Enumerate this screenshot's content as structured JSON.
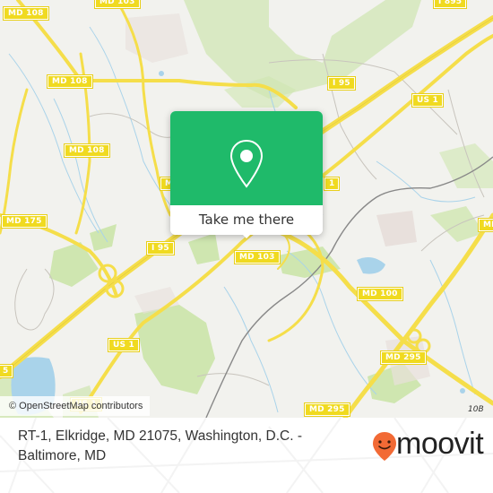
{
  "map": {
    "road_labels": [
      {
        "id": "md108-top",
        "text": "MD 108"
      },
      {
        "id": "md103-top",
        "text": "MD 103"
      },
      {
        "id": "i895-top",
        "text": "I 895"
      },
      {
        "id": "md108-mid",
        "text": "MD 108"
      },
      {
        "id": "i95-upper",
        "text": "I 95"
      },
      {
        "id": "us1-upper",
        "text": "US 1"
      },
      {
        "id": "md108-lower",
        "text": "MD 108"
      },
      {
        "id": "md-left-partial",
        "text": "M"
      },
      {
        "id": "us1-right-partial",
        "text": "1"
      },
      {
        "id": "md175",
        "text": "MD 175"
      },
      {
        "id": "i95-lower",
        "text": "I 95"
      },
      {
        "id": "md103",
        "text": "MD 103"
      },
      {
        "id": "md-right-partial",
        "text": "MD"
      },
      {
        "id": "md100",
        "text": "MD 100"
      },
      {
        "id": "us1-mid",
        "text": "US 1"
      },
      {
        "id": "md295-mid",
        "text": "MD 295"
      },
      {
        "id": "i95-left-partial",
        "text": "5"
      },
      {
        "id": "us1-low",
        "text": "US 1"
      },
      {
        "id": "md295-bottom",
        "text": "MD 295"
      }
    ],
    "exit_label": "10B",
    "colors": {
      "land": "#f2f2ee",
      "road": "#f5de4a",
      "park": "#c9e5a8",
      "water": "#a9d3ea",
      "shield": "#f0da20"
    }
  },
  "popup": {
    "icon": "map-pin-icon",
    "button_label": "Take me there",
    "color": "#1fba6a"
  },
  "attribution": "© OpenStreetMap contributors",
  "footer": {
    "address": "RT-1, Elkridge, MD 21075, Washington, D.C. - Baltimore, MD",
    "brand": "moovit",
    "brand_color": "#f26a35"
  }
}
